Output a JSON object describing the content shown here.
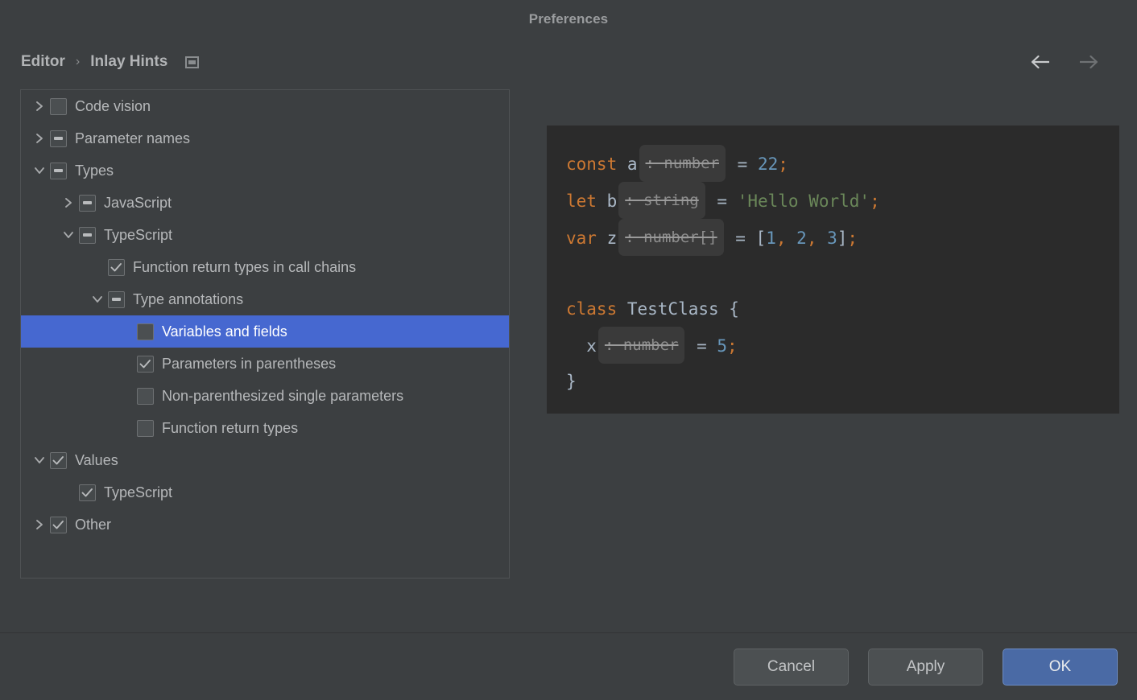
{
  "window": {
    "title": "Preferences"
  },
  "header": {
    "breadcrumb": {
      "root": "Editor",
      "separator": "›",
      "current": "Inlay Hints",
      "icon": "settings-preview-icon"
    },
    "nav": {
      "back_icon": "arrow-left-icon",
      "forward_icon": "arrow-right-icon",
      "back_enabled": true,
      "forward_enabled": false
    }
  },
  "tree": {
    "selected_index": 7,
    "selection_color": "#4668d0",
    "items": [
      {
        "label": "Code vision",
        "depth": 0,
        "twisty": "collapsed",
        "checkbox": "unchecked"
      },
      {
        "label": "Parameter names",
        "depth": 0,
        "twisty": "collapsed",
        "checkbox": "partial"
      },
      {
        "label": "Types",
        "depth": 0,
        "twisty": "expanded",
        "checkbox": "partial"
      },
      {
        "label": "JavaScript",
        "depth": 1,
        "twisty": "collapsed",
        "checkbox": "partial"
      },
      {
        "label": "TypeScript",
        "depth": 1,
        "twisty": "expanded",
        "checkbox": "partial"
      },
      {
        "label": "Function return types in call chains",
        "depth": 2,
        "twisty": "none",
        "checkbox": "checked"
      },
      {
        "label": "Type annotations",
        "depth": 2,
        "twisty": "expanded",
        "checkbox": "partial"
      },
      {
        "label": "Variables and fields",
        "depth": 3,
        "twisty": "none",
        "checkbox": "unchecked"
      },
      {
        "label": "Parameters in parentheses",
        "depth": 3,
        "twisty": "none",
        "checkbox": "checked"
      },
      {
        "label": "Non-parenthesized single parameters",
        "depth": 3,
        "twisty": "none",
        "checkbox": "unchecked"
      },
      {
        "label": "Function return types",
        "depth": 3,
        "twisty": "none",
        "checkbox": "unchecked"
      },
      {
        "label": "Values",
        "depth": 0,
        "twisty": "expanded",
        "checkbox": "checked"
      },
      {
        "label": "TypeScript",
        "depth": 1,
        "twisty": "none",
        "checkbox": "checked"
      },
      {
        "label": "Other",
        "depth": 0,
        "twisty": "collapsed",
        "checkbox": "checked"
      }
    ]
  },
  "preview": {
    "background": "#2b2b2b",
    "lines": [
      {
        "tokens": [
          {
            "text": "const",
            "type": "keyword"
          },
          {
            "text": " a",
            "type": "ident"
          },
          {
            "text": ": number",
            "type": "hint"
          },
          {
            "text": " = ",
            "type": "punct"
          },
          {
            "text": "22",
            "type": "number"
          },
          {
            "text": ";",
            "type": "semi"
          }
        ]
      },
      {
        "tokens": [
          {
            "text": "let",
            "type": "keyword"
          },
          {
            "text": " b",
            "type": "ident"
          },
          {
            "text": ": string",
            "type": "hint"
          },
          {
            "text": " = ",
            "type": "punct"
          },
          {
            "text": "'Hello World'",
            "type": "string"
          },
          {
            "text": ";",
            "type": "semi"
          }
        ]
      },
      {
        "tokens": [
          {
            "text": "var",
            "type": "keyword"
          },
          {
            "text": " z",
            "type": "ident"
          },
          {
            "text": ": number[]",
            "type": "hint"
          },
          {
            "text": " = [",
            "type": "punct"
          },
          {
            "text": "1",
            "type": "number"
          },
          {
            "text": ", ",
            "type": "semi"
          },
          {
            "text": "2",
            "type": "number"
          },
          {
            "text": ", ",
            "type": "semi"
          },
          {
            "text": "3",
            "type": "number"
          },
          {
            "text": "]",
            "type": "punct"
          },
          {
            "text": ";",
            "type": "semi"
          }
        ]
      },
      {
        "tokens": []
      },
      {
        "tokens": [
          {
            "text": "class",
            "type": "keyword"
          },
          {
            "text": " TestClass {",
            "type": "ident"
          }
        ]
      },
      {
        "tokens": [
          {
            "text": "  x",
            "type": "ident"
          },
          {
            "text": ": number",
            "type": "hint"
          },
          {
            "text": " = ",
            "type": "punct"
          },
          {
            "text": "5",
            "type": "number"
          },
          {
            "text": ";",
            "type": "semi"
          }
        ]
      },
      {
        "tokens": [
          {
            "text": "}",
            "type": "ident"
          }
        ]
      }
    ]
  },
  "footer": {
    "cancel_label": "Cancel",
    "apply_label": "Apply",
    "ok_label": "OK",
    "ok_color": "#4a6aa5"
  }
}
